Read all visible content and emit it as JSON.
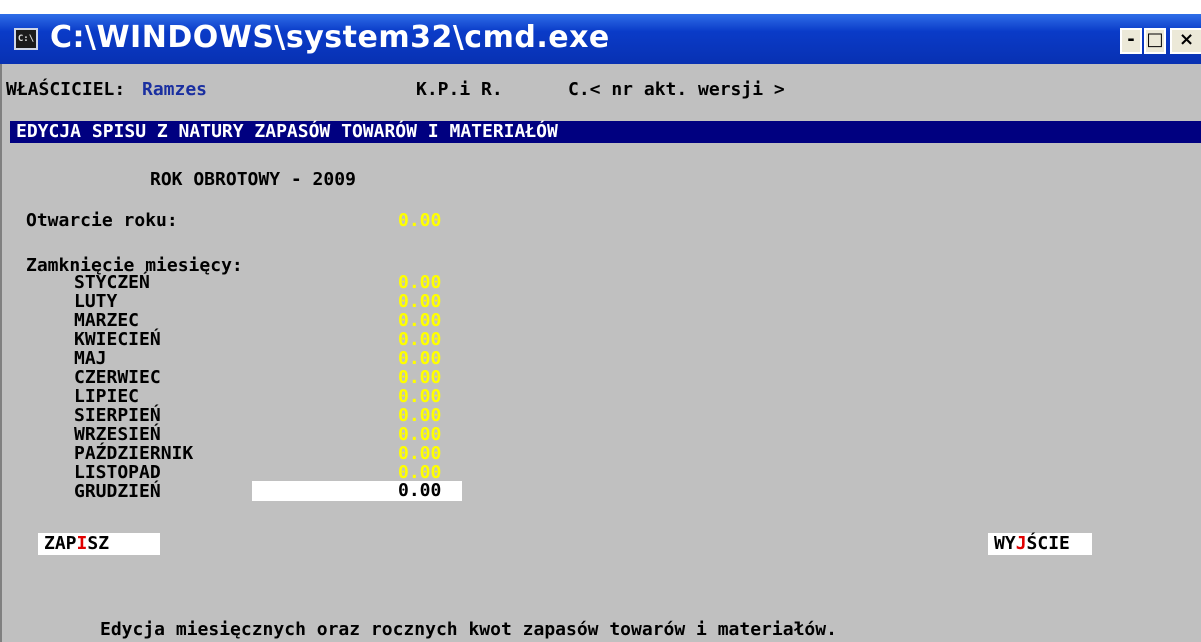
{
  "window": {
    "icon_label": "C:\\",
    "title": "C:\\WINDOWS\\system32\\cmd.exe",
    "min_glyph": "-",
    "max_glyph": "□",
    "close_glyph": "×"
  },
  "top_line": {
    "owner_label": "WŁAŚCICIEL:",
    "owner_name": "Ramzes",
    "program": "K.P.i R.",
    "version": "C.< nr akt. wersji >"
  },
  "header": {
    "title": "EDYCJA SPISU Z NATURY ZAPASÓW TOWARÓW I MATERIAŁÓW"
  },
  "year": {
    "label": "ROK OBROTOWY - 2009"
  },
  "opening": {
    "label": "Otwarcie roku:",
    "value": "0.00"
  },
  "closing": {
    "label": "Zamknięcie miesięcy:",
    "months": [
      {
        "name": "STYCZEŃ",
        "value": "0.00"
      },
      {
        "name": "LUTY",
        "value": "0.00"
      },
      {
        "name": "MARZEC",
        "value": "0.00"
      },
      {
        "name": "KWIECIEŃ",
        "value": "0.00"
      },
      {
        "name": "MAJ",
        "value": "0.00"
      },
      {
        "name": "CZERWIEC",
        "value": "0.00"
      },
      {
        "name": "LIPIEC",
        "value": "0.00"
      },
      {
        "name": "SIERPIEŃ",
        "value": "0.00"
      },
      {
        "name": "WRZESIEŃ",
        "value": "0.00"
      },
      {
        "name": "PAŹDZIERNIK",
        "value": "0.00"
      },
      {
        "name": "LISTOPAD",
        "value": "0.00"
      },
      {
        "name": "GRUDZIEŃ",
        "value": "0.00"
      }
    ]
  },
  "buttons": {
    "save_pre": "ZAP",
    "save_hot": "I",
    "save_post": "SZ",
    "exit_pre": "WY",
    "exit_hot": "J",
    "exit_post": "ŚCIE"
  },
  "status": {
    "text": "Edycja miesięcznych oraz rocznych kwot zapasów towarów i materiałów."
  },
  "colors": {
    "console_bg": "#c0c0c0",
    "header_bg": "#000080",
    "value_yellow": "#ffff00",
    "hotkey_red": "#e00000",
    "title_bar": "#0a3bc8"
  }
}
